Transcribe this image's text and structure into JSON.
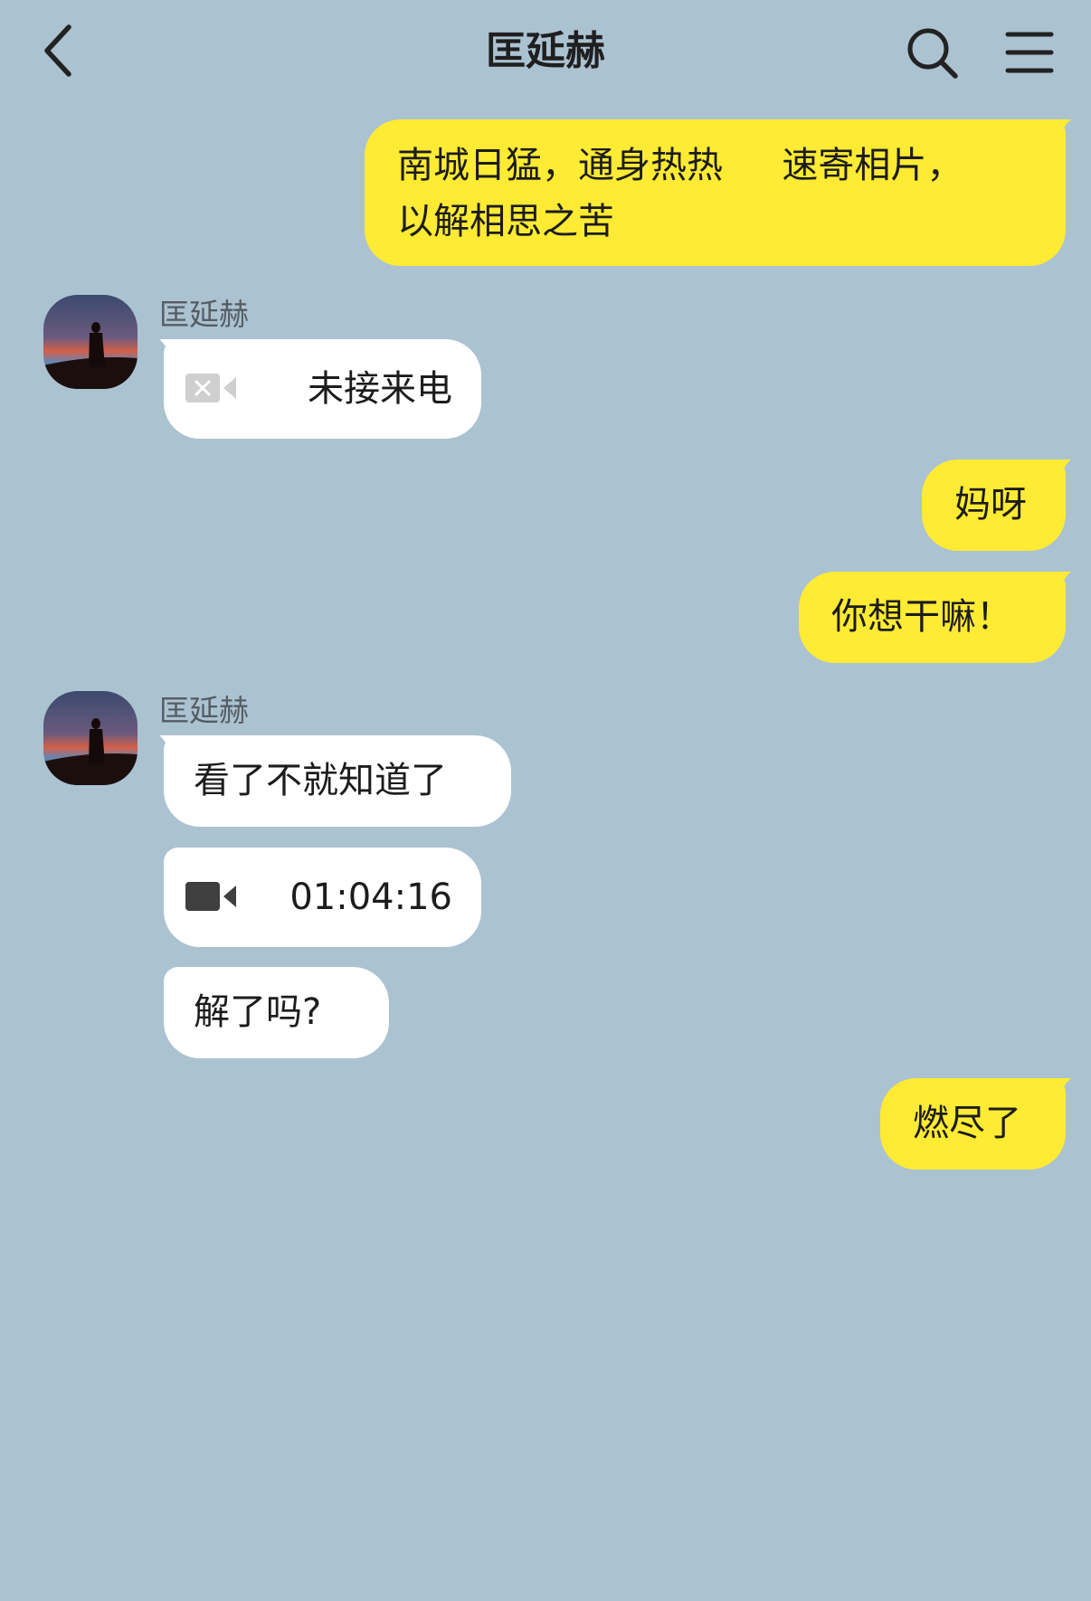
{
  "header": {
    "title": "匡延赫"
  },
  "colors": {
    "background": "#abc2d1",
    "my_bubble": "#ffeb34",
    "their_bubble": "#ffffff"
  },
  "messages": {
    "m1": {
      "line1": "南城日猛，通身热热 　 速寄相片，",
      "line2": "以解相思之苦"
    },
    "sender1": "匡延赫",
    "m2": {
      "text": "未接来电",
      "icon": "missed-video-call-icon"
    },
    "m3": {
      "text": "妈呀"
    },
    "m4": {
      "text": "你想干嘛！"
    },
    "sender2": "匡延赫",
    "m5": {
      "text": "看了不就知道了"
    },
    "m6": {
      "text": "01:04:16",
      "icon": "video-call-icon"
    },
    "m7": {
      "text": "解了吗?"
    },
    "m8": {
      "text": "燃尽了"
    }
  }
}
